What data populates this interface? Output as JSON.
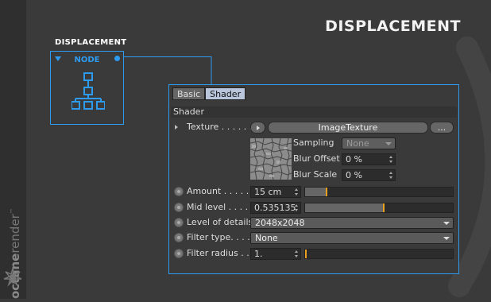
{
  "brand": {
    "part1": "octane",
    "part2": "render",
    "tm": "™"
  },
  "heading": "DISPLACEMENT",
  "node": {
    "title": "DISPLACEMENT",
    "label": "NODE"
  },
  "tabs": [
    {
      "label": "Basic"
    },
    {
      "label": "Shader"
    }
  ],
  "section": "Shader",
  "texture": {
    "label": "Texture . . . . . .",
    "button": "ImageTexture",
    "more": "..."
  },
  "sampling": {
    "label": "Sampling",
    "value": "None"
  },
  "blur_offset": {
    "label": "Blur Offset",
    "value": "0 %"
  },
  "blur_scale": {
    "label": "Blur Scale",
    "value": "0 %"
  },
  "amount": {
    "label": "Amount . . . . .",
    "value": "15 cm",
    "slider": 0.14
  },
  "mid_level": {
    "label": "Mid level . . . .",
    "value": "0.535135",
    "slider": 0.535
  },
  "level_of_details": {
    "label": "Level of details",
    "value": "2048x2048"
  },
  "filter_type": {
    "label": "Filter type. . . .",
    "value": "None"
  },
  "filter_radius": {
    "label": "Filter radius . .",
    "value": "1.",
    "slider": 0.0
  },
  "colors": {
    "accent": "#2d9bf0",
    "knob": "#e8a020"
  }
}
